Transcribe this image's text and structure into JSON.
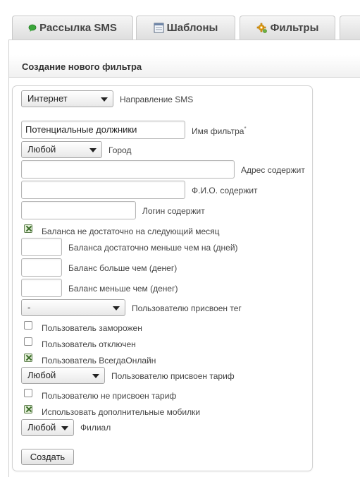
{
  "tabs": [
    {
      "label": "Рассылка SMS",
      "icon": "sms-bubble-icon"
    },
    {
      "label": "Шаблоны",
      "icon": "template-window-icon"
    },
    {
      "label": "Фильтры",
      "icon": "gear-filter-icon"
    }
  ],
  "section_title": "Создание нового фильтра",
  "form": {
    "direction": {
      "value": "Интернет",
      "label": "Направление SMS"
    },
    "filter_name": {
      "value": "Потенциальные должники",
      "label": "Имя фильтра",
      "required_mark": "*"
    },
    "city": {
      "value": "Любой",
      "label": "Город"
    },
    "address": {
      "value": "",
      "label": "Адрес содержит"
    },
    "fio": {
      "value": "",
      "label": "Ф.И.О. содержит"
    },
    "login": {
      "value": "",
      "label": "Логин содержит"
    },
    "balance_not_enough": {
      "checked": true,
      "label": "Баланса не достаточно на следующий месяц"
    },
    "balance_less_days": {
      "value": "",
      "label": "Баланса достаточно меньше чем на (дней)"
    },
    "balance_more": {
      "value": "",
      "label": "Баланс больше чем (денег)"
    },
    "balance_less": {
      "value": "",
      "label": "Баланс меньше чем (денег)"
    },
    "tag": {
      "value": "-",
      "label": "Пользователю присвоен тег"
    },
    "frozen": {
      "checked": false,
      "label": "Пользователь заморожен"
    },
    "disabled": {
      "checked": false,
      "label": "Пользователь отключен"
    },
    "always_online": {
      "checked": true,
      "label": "Пользователь ВсегдаОнлайн"
    },
    "tariff": {
      "value": "Любой",
      "label": "Пользователю присвоен тариф"
    },
    "no_tariff": {
      "checked": false,
      "label": "Пользователю не присвоен тариф"
    },
    "extra_mobiles": {
      "checked": true,
      "label": "Использовать дополнительные мобилки"
    },
    "branch": {
      "value": "Любой",
      "label": "Филиал"
    },
    "submit_label": "Создать"
  }
}
